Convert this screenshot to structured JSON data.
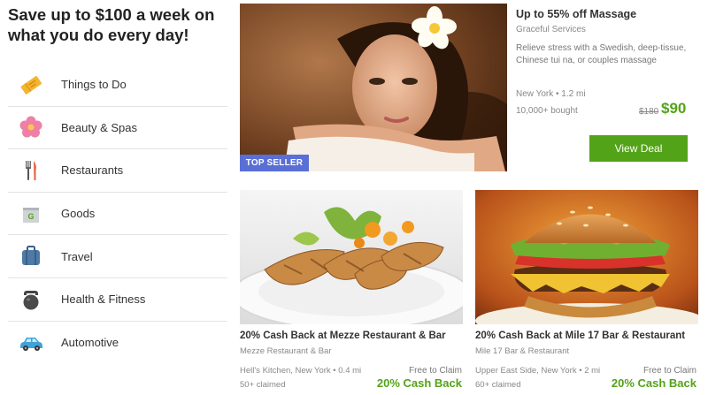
{
  "headline": "Save up to $100 a week on what you do every day!",
  "categories": [
    {
      "label": "Things to Do",
      "icon": "ticket-icon"
    },
    {
      "label": "Beauty & Spas",
      "icon": "flower-icon"
    },
    {
      "label": "Restaurants",
      "icon": "utensils-icon"
    },
    {
      "label": "Goods",
      "icon": "shopping-bag-icon"
    },
    {
      "label": "Travel",
      "icon": "luggage-icon"
    },
    {
      "label": "Health & Fitness",
      "icon": "kettlebell-icon"
    },
    {
      "label": "Automotive",
      "icon": "car-icon"
    }
  ],
  "featured": {
    "badge": "TOP SELLER",
    "title": "Up to 55% off Massage",
    "merchant": "Graceful Services",
    "description": "Relieve stress with a Swedish, deep-tissue, Chinese tui na, or couples massage",
    "location": "New York • 1.2 mi",
    "bought": "10,000+ bought",
    "original_price": "$180",
    "price": "$90",
    "button": "View Deal"
  },
  "cards": [
    {
      "title": "20% Cash Back at Mezze Restaurant & Bar",
      "merchant": "Mezze Restaurant & Bar",
      "location": "Hell's Kitchen, New York • 0.4 mi",
      "claimed": "50+ claimed",
      "free_text": "Free to Claim",
      "cash_back": "20% Cash Back"
    },
    {
      "title": "20% Cash Back at Mile 17 Bar & Restaurant",
      "merchant": "Mile 17 Bar & Restaurant",
      "location": "Upper East Side, New York • 2 mi",
      "claimed": "60+ claimed",
      "free_text": "Free to Claim",
      "cash_back": "20% Cash Back"
    }
  ],
  "colors": {
    "accent_green": "#53a318",
    "badge_blue": "#5a6fd6"
  }
}
